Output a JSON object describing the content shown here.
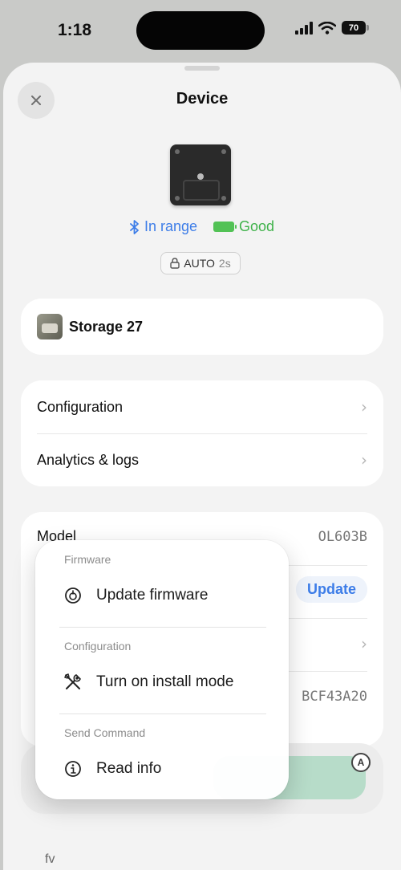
{
  "status_bar": {
    "time": "1:18",
    "battery": "70"
  },
  "sheet": {
    "title": "Device"
  },
  "device_status": {
    "connection": "In range",
    "battery": "Good"
  },
  "auto_badge": {
    "label": "AUTO",
    "seconds": "2s"
  },
  "storage": {
    "name": "Storage 27"
  },
  "nav": {
    "configuration": "Configuration",
    "analytics": "Analytics & logs"
  },
  "info": {
    "model_label": "Model",
    "model_value": "OL603B",
    "update_label": "Update",
    "id_value": "BCF43A20"
  },
  "menu": {
    "sections": {
      "firmware": "Firmware",
      "configuration": "Configuration",
      "send_command": "Send Command"
    },
    "items": {
      "update_firmware": "Update firmware",
      "install_mode": "Turn on install mode",
      "read_info": "Read info"
    }
  },
  "footer": {
    "partial": "fv"
  },
  "colors": {
    "accent": "#3d7de8",
    "good": "#3fb24a",
    "green_button": "#b7dcc9"
  }
}
